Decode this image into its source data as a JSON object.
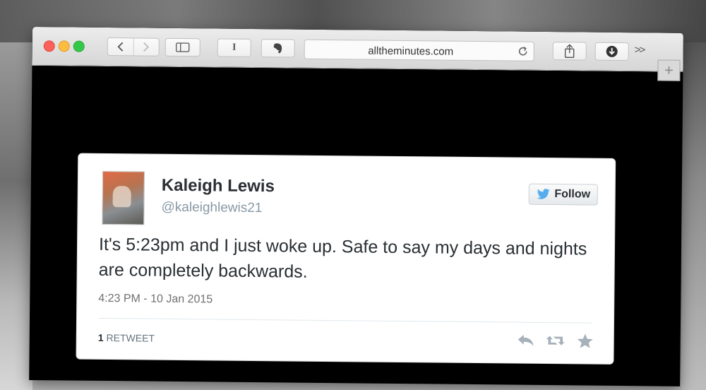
{
  "browser": {
    "url": "alltheminutes.com",
    "more_label": ">>",
    "new_tab_label": "+",
    "reader_label": "I"
  },
  "tweet": {
    "author_name": "Kaleigh Lewis",
    "handle": "@kaleighlewis21",
    "follow_label": "Follow",
    "text": "It's 5:23pm and I just woke up. Safe to say my days and nights are completely backwards.",
    "timestamp": "4:23 PM - 10 Jan 2015",
    "retweet_count": "1",
    "retweet_label": "RETWEET"
  },
  "colors": {
    "twitter_blue": "#55acee",
    "close": "#fc605b",
    "minimize": "#fdbc40",
    "maximize": "#34c84a"
  }
}
